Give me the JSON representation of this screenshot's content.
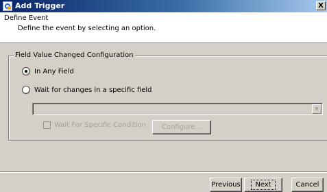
{
  "window": {
    "title": "Add Trigger",
    "close_glyph": "X"
  },
  "header": {
    "title": "Define Event",
    "description": "Define the event by selecting an option."
  },
  "group": {
    "legend": "Field Value Changed Configuration",
    "options": [
      {
        "label": "In Any Field",
        "selected": true
      },
      {
        "label": "Wait for changes in a specific field",
        "selected": false
      }
    ],
    "field_select": {
      "value": "",
      "enabled": false,
      "arrow_glyph": "▼"
    },
    "condition_checkbox": {
      "label": "Wait For Specific Condition",
      "checked": false,
      "enabled": false
    },
    "configure_button": {
      "label": "Configure...",
      "enabled": false
    }
  },
  "footer": {
    "previous_label": "Previous",
    "next_label": "Next",
    "cancel_label": "Cancel"
  }
}
